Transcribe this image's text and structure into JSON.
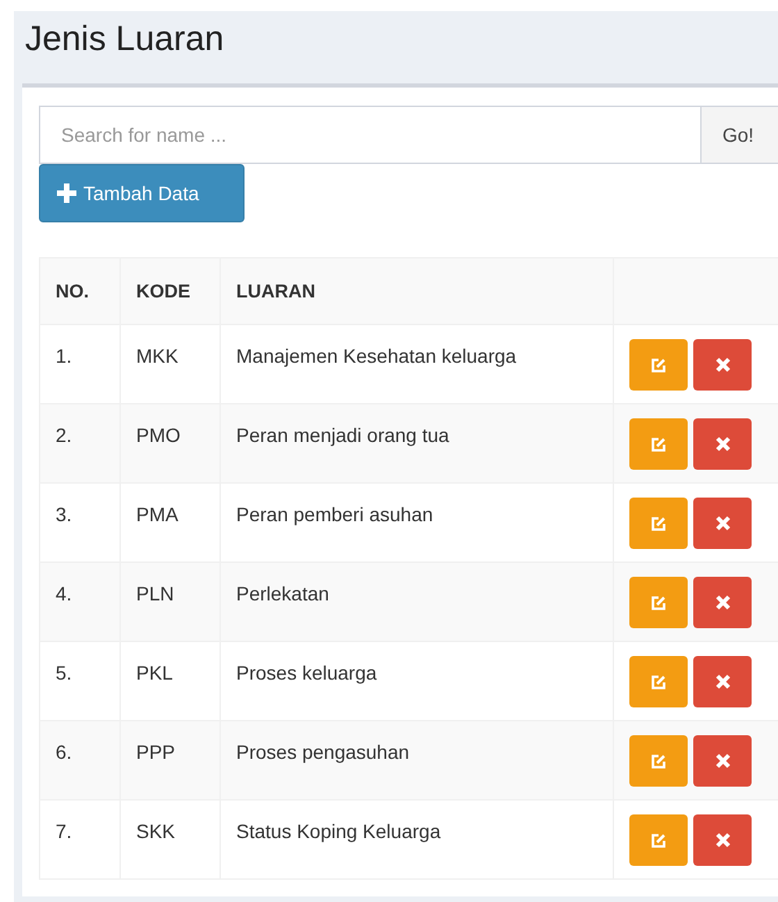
{
  "page_title": "Jenis Luaran",
  "search": {
    "placeholder": "Search for name ...",
    "button": "Go!"
  },
  "add_button": {
    "label": "Tambah Data"
  },
  "table": {
    "columns": [
      "NO.",
      "KODE",
      "LUARAN"
    ],
    "rows": [
      {
        "no": "1.",
        "kode": "MKK",
        "luaran": "Manajemen Kesehatan keluarga"
      },
      {
        "no": "2.",
        "kode": "PMO",
        "luaran": "Peran menjadi orang tua"
      },
      {
        "no": "3.",
        "kode": "PMA",
        "luaran": "Peran pemberi asuhan"
      },
      {
        "no": "4.",
        "kode": "PLN",
        "luaran": "Perlekatan"
      },
      {
        "no": "5.",
        "kode": "PKL",
        "luaran": "Proses keluarga"
      },
      {
        "no": "6.",
        "kode": "PPP",
        "luaran": "Proses pengasuhan"
      },
      {
        "no": "7.",
        "kode": "SKK",
        "luaran": "Status Koping Keluarga"
      }
    ]
  }
}
